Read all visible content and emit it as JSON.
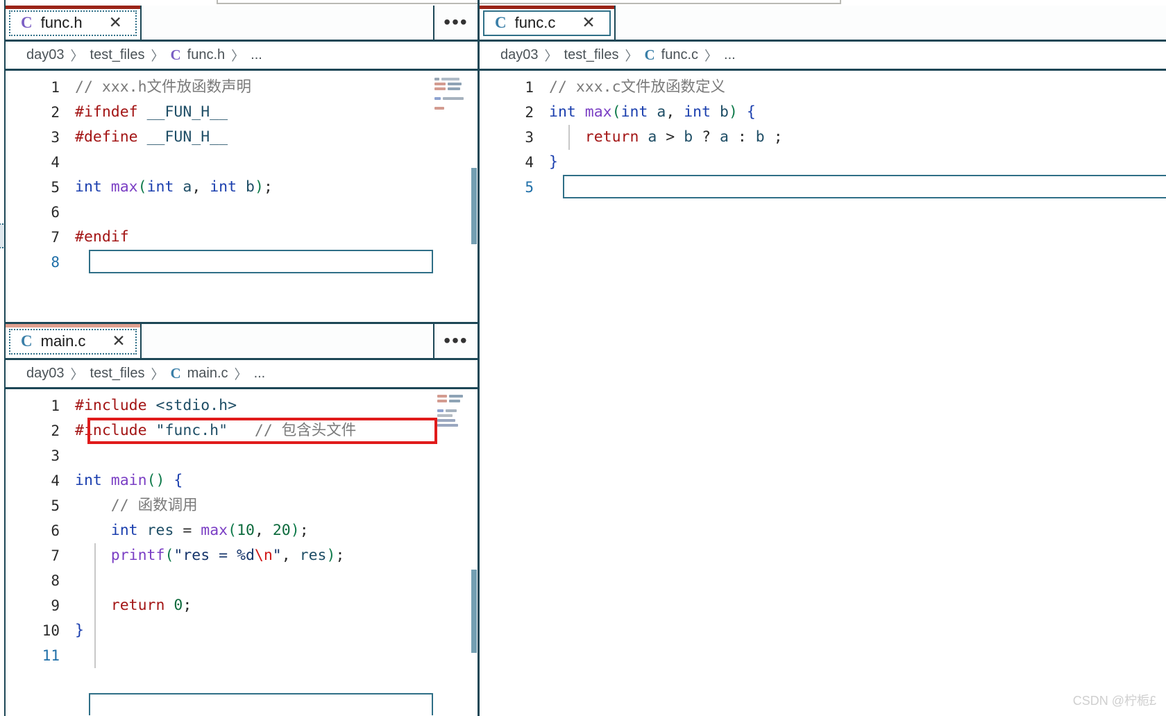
{
  "app": {
    "kind": "code-editor",
    "watermark": "CSDN @柠栀£"
  },
  "colors": {
    "tab_active_accent": "#9b2418",
    "panel_border": "#1d4756",
    "focus_ring": "#2f6f87",
    "annotation_red": "#e01b1b",
    "preprocessor": "#a31515",
    "keyword": "#1b3fae",
    "function": "#7b3fc4",
    "number": "#0e6b3d",
    "comment": "#7a7a7a",
    "string": "#16356b",
    "escape": "#d01616",
    "macro": "#1f4e66",
    "line_number_active": "#1f6fa8"
  },
  "icons": {
    "c_file": "C",
    "close": "✕",
    "more_actions": "•••",
    "breadcrumb_separator": "〉",
    "breadcrumb_more": "..."
  },
  "groups": [
    {
      "id": "func-h",
      "tab": {
        "label": "func.h",
        "icon": "c-file-icon",
        "close": "✕",
        "active": true,
        "focused": true
      },
      "actions_label": "•••",
      "breadcrumb": {
        "parts": [
          "day03",
          "test_files",
          "func.h"
        ],
        "trailing": "..."
      },
      "code": {
        "language": "c",
        "active_line": 8,
        "lines": [
          {
            "n": 1,
            "tokens": [
              {
                "t": "// xxx.h文件放函数声明",
                "c": "t-cmt"
              }
            ]
          },
          {
            "n": 2,
            "tokens": [
              {
                "t": "#ifndef",
                "c": "t-pre"
              },
              {
                "t": " ",
                "c": "t-op"
              },
              {
                "t": "__FUN_H__",
                "c": "t-macro"
              }
            ]
          },
          {
            "n": 3,
            "tokens": [
              {
                "t": "#define",
                "c": "t-pre"
              },
              {
                "t": " ",
                "c": "t-op"
              },
              {
                "t": "__FUN_H__",
                "c": "t-macro"
              }
            ]
          },
          {
            "n": 4,
            "tokens": []
          },
          {
            "n": 5,
            "tokens": [
              {
                "t": "int",
                "c": "t-kw"
              },
              {
                "t": " ",
                "c": "t-op"
              },
              {
                "t": "max",
                "c": "t-fn"
              },
              {
                "t": "(",
                "c": "t-paren"
              },
              {
                "t": "int",
                "c": "t-kw"
              },
              {
                "t": " ",
                "c": "t-op"
              },
              {
                "t": "a",
                "c": "t-var"
              },
              {
                "t": ", ",
                "c": "t-op"
              },
              {
                "t": "int",
                "c": "t-kw"
              },
              {
                "t": " ",
                "c": "t-op"
              },
              {
                "t": "b",
                "c": "t-var"
              },
              {
                "t": ")",
                "c": "t-paren"
              },
              {
                "t": ";",
                "c": "t-op"
              }
            ]
          },
          {
            "n": 6,
            "tokens": []
          },
          {
            "n": 7,
            "tokens": [
              {
                "t": "#endif",
                "c": "t-pre"
              }
            ]
          },
          {
            "n": 8,
            "tokens": []
          }
        ]
      }
    },
    {
      "id": "func-c",
      "tab": {
        "label": "func.c",
        "icon": "c-file-icon",
        "close": "✕",
        "active": true,
        "focused": true
      },
      "breadcrumb": {
        "parts": [
          "day03",
          "test_files",
          "func.c"
        ],
        "trailing": "..."
      },
      "code": {
        "language": "c",
        "active_line": 5,
        "lines": [
          {
            "n": 1,
            "tokens": [
              {
                "t": "// xxx.c文件放函数定义",
                "c": "t-cmt"
              }
            ]
          },
          {
            "n": 2,
            "tokens": [
              {
                "t": "int",
                "c": "t-kw"
              },
              {
                "t": " ",
                "c": "t-op"
              },
              {
                "t": "max",
                "c": "t-fn"
              },
              {
                "t": "(",
                "c": "t-paren"
              },
              {
                "t": "int",
                "c": "t-kw"
              },
              {
                "t": " ",
                "c": "t-op"
              },
              {
                "t": "a",
                "c": "t-var"
              },
              {
                "t": ", ",
                "c": "t-op"
              },
              {
                "t": "int",
                "c": "t-kw"
              },
              {
                "t": " ",
                "c": "t-op"
              },
              {
                "t": "b",
                "c": "t-var"
              },
              {
                "t": ")",
                "c": "t-paren"
              },
              {
                "t": " ",
                "c": "t-op"
              },
              {
                "t": "{",
                "c": "t-punc"
              }
            ]
          },
          {
            "n": 3,
            "tokens": [
              {
                "t": "    ",
                "c": "t-op"
              },
              {
                "t": "return",
                "c": "t-kw2"
              },
              {
                "t": " ",
                "c": "t-op"
              },
              {
                "t": "a",
                "c": "t-var"
              },
              {
                "t": " > ",
                "c": "t-op"
              },
              {
                "t": "b",
                "c": "t-var"
              },
              {
                "t": " ? ",
                "c": "t-op"
              },
              {
                "t": "a",
                "c": "t-var"
              },
              {
                "t": " : ",
                "c": "t-op"
              },
              {
                "t": "b",
                "c": "t-var"
              },
              {
                "t": " ;",
                "c": "t-op"
              }
            ]
          },
          {
            "n": 4,
            "tokens": [
              {
                "t": "}",
                "c": "t-punc"
              }
            ]
          },
          {
            "n": 5,
            "tokens": []
          }
        ]
      }
    },
    {
      "id": "main-c",
      "tab": {
        "label": "main.c",
        "icon": "c-file-icon",
        "close": "✕",
        "active": true,
        "focused": true
      },
      "actions_label": "•••",
      "breadcrumb": {
        "parts": [
          "day03",
          "test_files",
          "main.c"
        ],
        "trailing": "..."
      },
      "annotation": {
        "line": 2,
        "color": "#e01b1b",
        "shape": "rectangle"
      },
      "code": {
        "language": "c",
        "active_line": 11,
        "lines": [
          {
            "n": 1,
            "tokens": [
              {
                "t": "#include",
                "c": "t-pre"
              },
              {
                "t": " ",
                "c": "t-op"
              },
              {
                "t": "<stdio.h>",
                "c": "t-hdr"
              }
            ]
          },
          {
            "n": 2,
            "tokens": [
              {
                "t": "#include",
                "c": "t-pre"
              },
              {
                "t": " ",
                "c": "t-op"
              },
              {
                "t": "\"func.h\"",
                "c": "t-hdr"
              },
              {
                "t": "   ",
                "c": "t-op"
              },
              {
                "t": "// 包含头文件",
                "c": "t-cmt"
              }
            ]
          },
          {
            "n": 3,
            "tokens": []
          },
          {
            "n": 4,
            "tokens": [
              {
                "t": "int",
                "c": "t-kw"
              },
              {
                "t": " ",
                "c": "t-op"
              },
              {
                "t": "main",
                "c": "t-fn"
              },
              {
                "t": "()",
                "c": "t-paren"
              },
              {
                "t": " ",
                "c": "t-op"
              },
              {
                "t": "{",
                "c": "t-punc"
              }
            ]
          },
          {
            "n": 5,
            "tokens": [
              {
                "t": "    ",
                "c": "t-op"
              },
              {
                "t": "// 函数调用",
                "c": "t-cmt"
              }
            ]
          },
          {
            "n": 6,
            "tokens": [
              {
                "t": "    ",
                "c": "t-op"
              },
              {
                "t": "int",
                "c": "t-kw"
              },
              {
                "t": " ",
                "c": "t-op"
              },
              {
                "t": "res",
                "c": "t-var"
              },
              {
                "t": " = ",
                "c": "t-op"
              },
              {
                "t": "max",
                "c": "t-fn"
              },
              {
                "t": "(",
                "c": "t-paren"
              },
              {
                "t": "10",
                "c": "t-num"
              },
              {
                "t": ", ",
                "c": "t-op"
              },
              {
                "t": "20",
                "c": "t-num"
              },
              {
                "t": ")",
                "c": "t-paren"
              },
              {
                "t": ";",
                "c": "t-op"
              }
            ]
          },
          {
            "n": 7,
            "tokens": [
              {
                "t": "    ",
                "c": "t-op"
              },
              {
                "t": "printf",
                "c": "t-fn"
              },
              {
                "t": "(",
                "c": "t-paren"
              },
              {
                "t": "\"res = %d",
                "c": "t-str"
              },
              {
                "t": "\\n",
                "c": "t-esc"
              },
              {
                "t": "\"",
                "c": "t-str"
              },
              {
                "t": ", ",
                "c": "t-op"
              },
              {
                "t": "res",
                "c": "t-var"
              },
              {
                "t": ")",
                "c": "t-paren"
              },
              {
                "t": ";",
                "c": "t-op"
              }
            ]
          },
          {
            "n": 8,
            "tokens": []
          },
          {
            "n": 9,
            "tokens": [
              {
                "t": "    ",
                "c": "t-op"
              },
              {
                "t": "return",
                "c": "t-kw2"
              },
              {
                "t": " ",
                "c": "t-op"
              },
              {
                "t": "0",
                "c": "t-num"
              },
              {
                "t": ";",
                "c": "t-op"
              }
            ]
          },
          {
            "n": 10,
            "tokens": [
              {
                "t": "}",
                "c": "t-punc"
              }
            ]
          },
          {
            "n": 11,
            "tokens": []
          }
        ]
      }
    }
  ]
}
